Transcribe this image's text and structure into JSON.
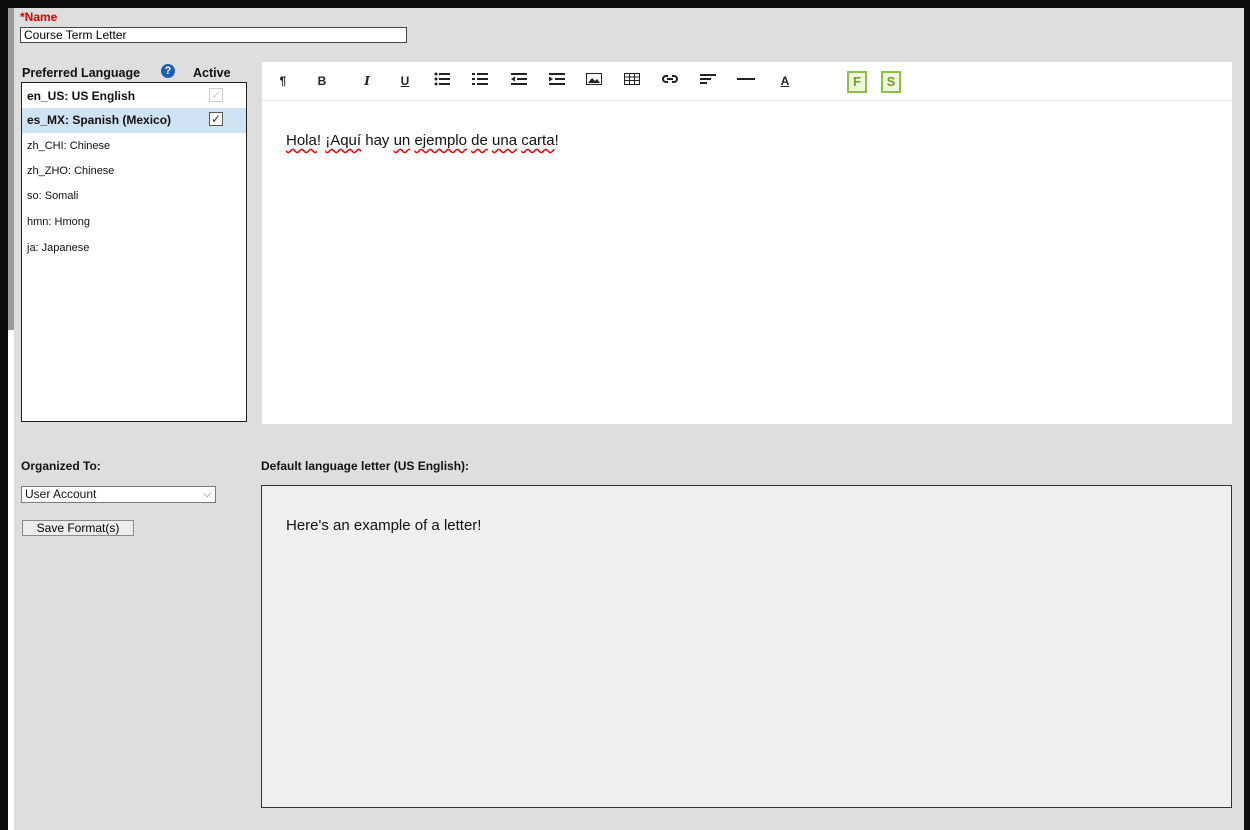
{
  "name_field": {
    "label": "*Name",
    "value": "Course Term Letter"
  },
  "languages": {
    "header": "Preferred Language",
    "active_header": "Active",
    "help_icon": "?",
    "items": [
      {
        "label": "en_US: US English",
        "bold": true,
        "checkbox": "disabled-checked"
      },
      {
        "label": "es_MX: Spanish (Mexico)",
        "bold": true,
        "selected": true,
        "checkbox": "checked"
      },
      {
        "label": "zh_CHI: Chinese"
      },
      {
        "label": "zh_ZHO: Chinese"
      },
      {
        "label": "so: Somali"
      },
      {
        "label": "hmn: Hmong"
      },
      {
        "label": "ja: Japanese"
      }
    ]
  },
  "toolbar": {
    "paragraph": "¶",
    "bold": "B",
    "italic": "I",
    "underline": "U",
    "text_color": "A",
    "field_button": "F",
    "sub_button": "S",
    "icons": [
      "paragraph-icon",
      "bold-icon",
      "italic-icon",
      "underline-icon",
      "bulleted-list-icon",
      "numbered-list-icon",
      "outdent-icon",
      "indent-icon",
      "image-icon",
      "table-icon",
      "link-icon",
      "align-icon",
      "horizontal-rule-icon",
      "text-color-icon",
      "field-icon",
      "sub-report-icon"
    ]
  },
  "editor": {
    "words": [
      "Hola",
      "! ",
      "¡Aquí",
      " hay ",
      "un",
      " ",
      "ejemplo",
      " ",
      "de",
      " ",
      "una",
      " ",
      "carta",
      "!"
    ]
  },
  "organized_to": {
    "label": "Organized To:",
    "value": "User Account"
  },
  "save_button": "Save Format(s)",
  "default_letter": {
    "label": "Default language letter (US English):",
    "text": "Here's an example of a letter!"
  },
  "colors": {
    "required": "#e00000",
    "selected_row": "#cfe3f5",
    "help_icon": "#1c5fb4",
    "accent_green": "#8bbf45"
  }
}
